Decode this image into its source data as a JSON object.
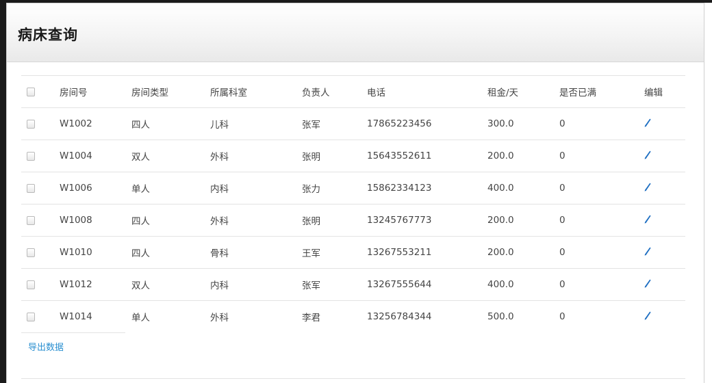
{
  "page": {
    "title": "病床查询"
  },
  "table": {
    "headers": {
      "room": "房间号",
      "type": "房间类型",
      "dept": "所属科室",
      "head": "负责人",
      "phone": "电话",
      "rent": "租金/天",
      "full": "是否已满",
      "edit": "编辑"
    },
    "rows": [
      {
        "room": "W1002",
        "type": "四人",
        "dept": "儿科",
        "head": "张军",
        "phone": "17865223456",
        "rent": "300.0",
        "full": "0"
      },
      {
        "room": "W1004",
        "type": "双人",
        "dept": "外科",
        "head": "张明",
        "phone": "15643552611",
        "rent": "200.0",
        "full": "0"
      },
      {
        "room": "W1006",
        "type": "单人",
        "dept": "内科",
        "head": "张力",
        "phone": "15862334123",
        "rent": "400.0",
        "full": "0"
      },
      {
        "room": "W1008",
        "type": "四人",
        "dept": "外科",
        "head": "张明",
        "phone": "13245767773",
        "rent": "200.0",
        "full": "0"
      },
      {
        "room": "W1010",
        "type": "四人",
        "dept": "骨科",
        "head": "王军",
        "phone": "13267553211",
        "rent": "200.0",
        "full": "0"
      },
      {
        "room": "W1012",
        "type": "双人",
        "dept": "内科",
        "head": "张军",
        "phone": "13267555644",
        "rent": "400.0",
        "full": "0"
      },
      {
        "room": "W1014",
        "type": "单人",
        "dept": "外科",
        "head": "李君",
        "phone": "13256784344",
        "rent": "500.0",
        "full": "0"
      }
    ]
  },
  "footer": {
    "export_label": "导出数据"
  },
  "icons": {
    "checkbox": "checkbox-icon",
    "edit": "pencil-icon"
  },
  "colors": {
    "link": "#2a8fd0",
    "edit_icon": "#1f6fc2"
  }
}
